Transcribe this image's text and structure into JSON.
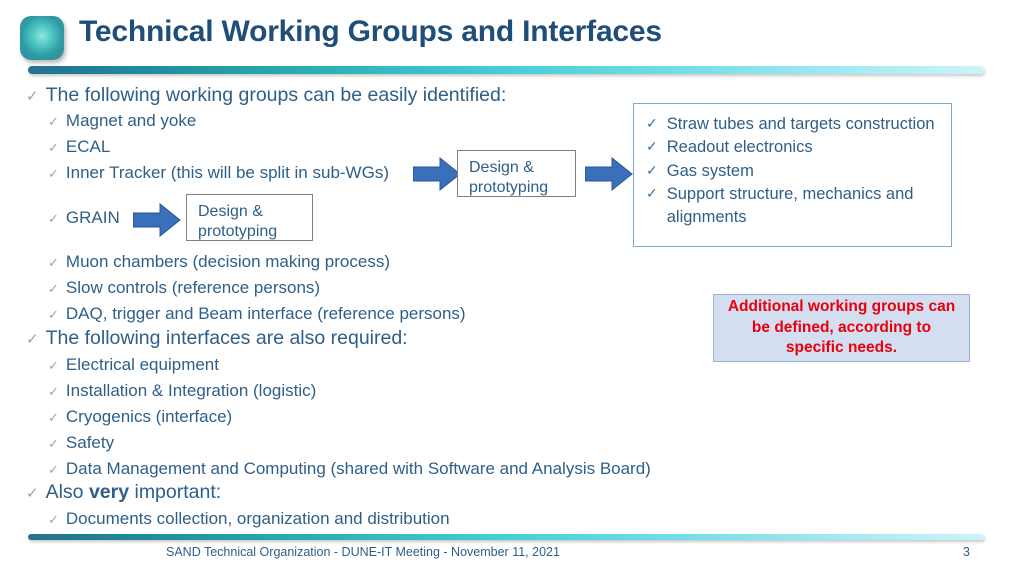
{
  "slide": {
    "title": "Technical Working Groups and Interfaces",
    "icon": "rounded-square-icon",
    "accent_dark": "#2a6f8e",
    "accent_light": "#cdf3fa",
    "title_color": "#1f4e79",
    "body_color": "#2e5f88"
  },
  "bullets": [
    {
      "level": 1,
      "text": "The following working groups can be easily identified:",
      "tick": "✓"
    },
    {
      "level": 2,
      "text": "Magnet and yoke",
      "tick": "✓"
    },
    {
      "level": 2,
      "text": "ECAL",
      "tick": "✓"
    },
    {
      "level": 2,
      "text": "Inner Tracker (this will be split in sub-WGs)",
      "tick": "✓"
    },
    {
      "level": 2,
      "text": "GRAIN",
      "tick": "✓"
    },
    {
      "level": 2,
      "text": "Muon chambers (decision making process)",
      "tick": "✓"
    },
    {
      "level": 2,
      "text": "Slow controls (reference persons)",
      "tick": "✓"
    },
    {
      "level": 2,
      "text": "DAQ, trigger and Beam interface (reference persons)",
      "tick": "✓"
    },
    {
      "level": 1,
      "text": "The following interfaces are also required:",
      "tick": "✓"
    },
    {
      "level": 2,
      "text": "Electrical equipment",
      "tick": "✓"
    },
    {
      "level": 2,
      "text": "Installation & Integration (logistic)",
      "tick": "✓"
    },
    {
      "level": 2,
      "text": "Cryogenics (interface)",
      "tick": "✓"
    },
    {
      "level": 2,
      "text": "Safety",
      "tick": "✓"
    },
    {
      "level": 2,
      "text": "Data Management and Computing (shared with Software and Analysis Board)",
      "tick": "✓"
    },
    {
      "level": 2,
      "text": "Documents collection, organization and distribution",
      "tick": "✓"
    }
  ],
  "also_important": {
    "tick": "✓",
    "prefix": "Also ",
    "emphasis": "very",
    "suffix": " important:"
  },
  "flow": {
    "box_tracker": {
      "line1": "Design &",
      "line2": "prototyping"
    },
    "box_grain": {
      "line1": "Design &",
      "line2": "prototyping"
    },
    "arrow_color": "#3a6fba",
    "box_border_color": "#808080"
  },
  "straw_box": {
    "border_color": "#7fa6d3",
    "tick": "✓",
    "items": [
      "Straw tubes and targets construction",
      "Readout electronics",
      "Gas system",
      "Support structure, mechanics and alignments"
    ]
  },
  "note_box": {
    "text": "Additional working groups can be defined, according to specific needs.",
    "text_color": "#e8000d",
    "fill_color": "#d3def0",
    "border_color": "#9cb4d8"
  },
  "footer": {
    "text": "SAND Technical Organization - DUNE-IT Meeting - November 11, 2021",
    "page_number": "3"
  }
}
